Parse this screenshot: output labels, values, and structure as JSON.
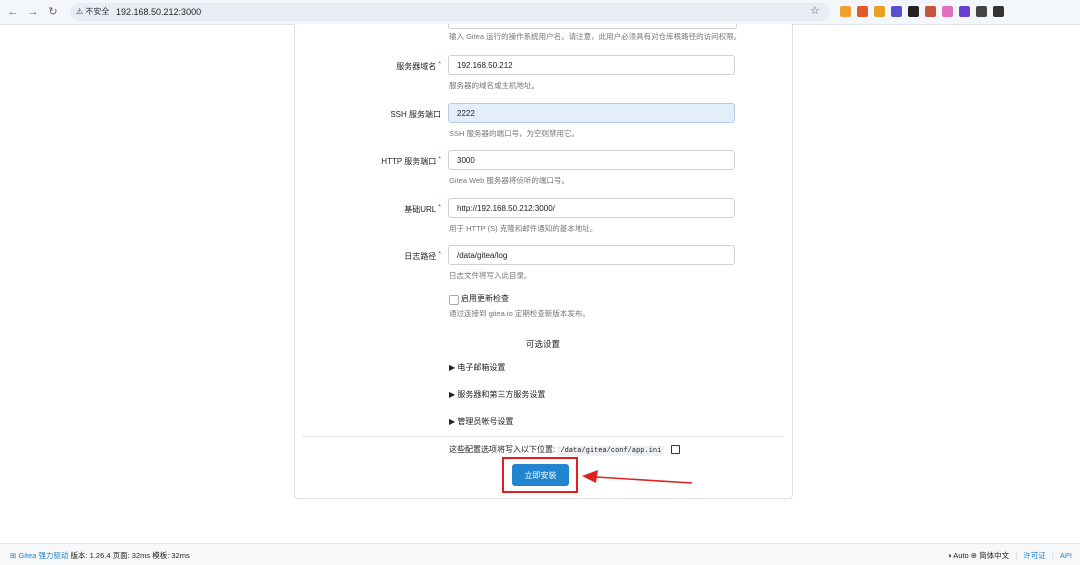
{
  "browser": {
    "security_label": "⚠ 不安全",
    "url": "192.168.50.212:3000",
    "extension_colors": [
      "#f0a030",
      "#e05a2a",
      "#e8a020",
      "#5a4fcf",
      "#222222",
      "#c2553a",
      "#e070c0",
      "#6a3fd0",
      "#444444",
      "#333333"
    ]
  },
  "top_help": "输入 Gitea 运行的操作系统用户名。请注意，此用户必须具有对仓库根路径的访问权限。",
  "fields": {
    "domain": {
      "label": "服务器域名",
      "value": "192.168.50.212",
      "help": "服务器的域名或主机地址。"
    },
    "ssh_port": {
      "label": "SSH 服务端口",
      "value": "2222",
      "help": "SSH 服务器的端口号，为空则禁用它。"
    },
    "http_port": {
      "label": "HTTP 服务端口",
      "value": "3000",
      "help": "Gitea Web 服务器将侦听的端口号。"
    },
    "base_url": {
      "label": "基础URL",
      "value": "http://192.168.50.212:3000/",
      "help": "用于 HTTP (S) 克隆和邮件通知的基本地址。"
    },
    "log_path": {
      "label": "日志路径",
      "value": "/data/gitea/log",
      "help": "日志文件将写入此目录。"
    }
  },
  "update_check": {
    "label": "启用更新检查",
    "help": "通过连接到 gitea.io 定期检查新版本发布。"
  },
  "optional": {
    "title": "可选设置",
    "sections": [
      "▶ 电子邮箱设置",
      "▶ 服务器和第三方服务设置",
      "▶ 管理员帐号设置"
    ]
  },
  "config_note": {
    "text": "这些配置选项将写入以下位置:",
    "path": "/data/gitea/conf/app.ini"
  },
  "install_button": "立即安装",
  "footer": {
    "powered": "⊞ Gitea 强力驱动",
    "version": "版本: 1.26.4",
    "page": "页面: 32ms",
    "template": "模板: 32ms",
    "theme": "◑ Auto",
    "language": "⊕ 简体中文",
    "license": "许可证",
    "api": "API"
  }
}
